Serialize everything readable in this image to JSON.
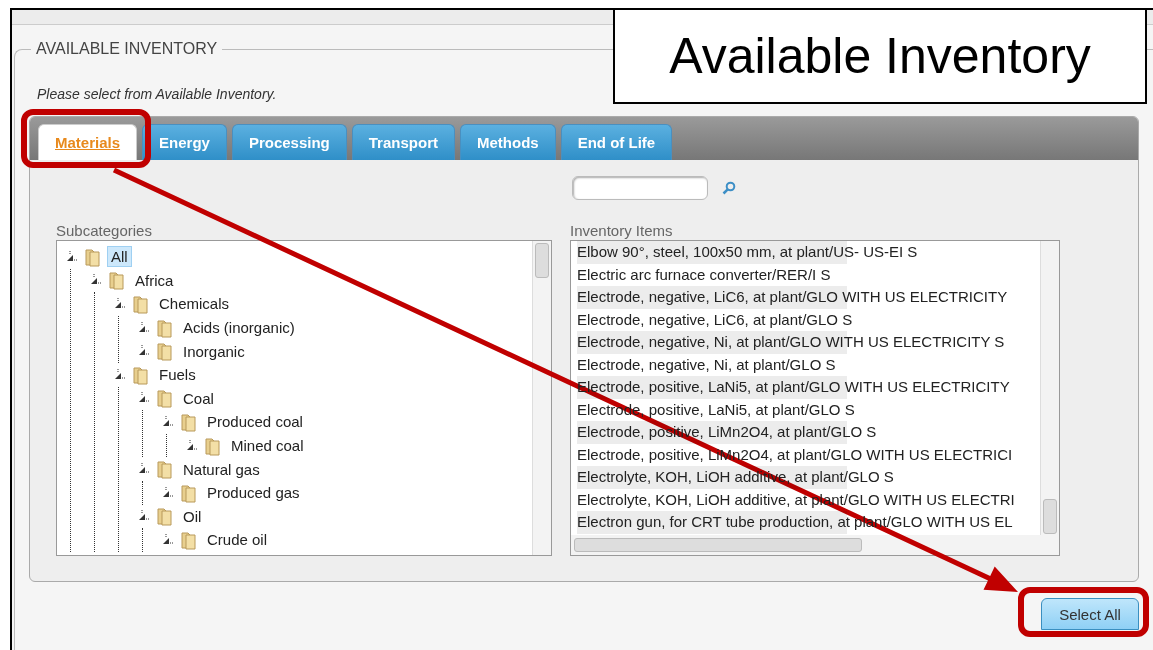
{
  "callout": {
    "text": "Available Inventory"
  },
  "section": {
    "legend": "AVAILABLE INVENTORY",
    "instruction": "Please select from Available Inventory."
  },
  "tabs": [
    {
      "label": "Materials",
      "selected": true
    },
    {
      "label": "Energy",
      "selected": false
    },
    {
      "label": "Processing",
      "selected": false
    },
    {
      "label": "Transport",
      "selected": false
    },
    {
      "label": "Methods",
      "selected": false
    },
    {
      "label": "End of Life",
      "selected": false
    }
  ],
  "subcategories": {
    "label": "Subcategories",
    "tree": [
      {
        "label": "All",
        "selected": true,
        "children": [
          {
            "label": "Africa",
            "selected": false,
            "children": [
              {
                "label": "Chemicals",
                "selected": false,
                "children": [
                  {
                    "label": "Acids (inorganic)",
                    "selected": false
                  },
                  {
                    "label": "Inorganic",
                    "selected": false
                  }
                ]
              },
              {
                "label": "Fuels",
                "selected": false,
                "children": [
                  {
                    "label": "Coal",
                    "selected": false,
                    "children": [
                      {
                        "label": "Produced coal",
                        "selected": false,
                        "children": [
                          {
                            "label": "Mined coal",
                            "selected": false
                          }
                        ]
                      }
                    ]
                  },
                  {
                    "label": "Natural gas",
                    "selected": false,
                    "children": [
                      {
                        "label": "Produced gas",
                        "selected": false
                      }
                    ]
                  },
                  {
                    "label": "Oil",
                    "selected": false,
                    "children": [
                      {
                        "label": "Crude oil",
                        "selected": false
                      }
                    ]
                  }
                ]
              }
            ]
          }
        ]
      }
    ]
  },
  "inventory": {
    "label": "Inventory Items",
    "items": [
      "Elbow 90°, steel, 100x50 mm, at plant/US- US-EI S",
      "Electric arc furnace converter/RER/I S",
      "Electrode, negative, LiC6, at plant/GLO WITH US ELECTRICITY",
      "Electrode, negative, LiC6, at plant/GLO S",
      "Electrode, negative, Ni, at plant/GLO WITH US ELECTRICITY S",
      "Electrode, negative, Ni, at plant/GLO S",
      "Electrode, positive, LaNi5, at plant/GLO WITH US ELECTRICITY",
      "Electrode, positive, LaNi5, at plant/GLO S",
      "Electrode, positive, LiMn2O4, at plant/GLO S",
      "Electrode, positive, LiMn2O4, at plant/GLO WITH US ELECTRICI",
      "Electrolyte, KOH, LiOH additive, at plant/GLO S",
      "Electrolyte, KOH, LiOH additive, at plant/GLO WITH US ELECTRI",
      "Electron gun, for CRT tube production, at plant/GLO WITH US EL"
    ]
  },
  "select_all_button": {
    "label": "Select All"
  }
}
